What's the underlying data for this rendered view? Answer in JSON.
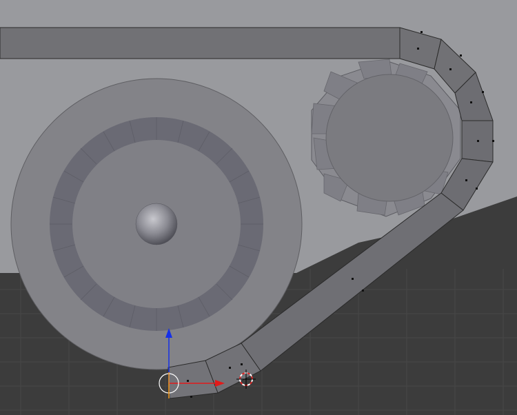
{
  "app": {
    "name": "3D viewport",
    "mode": "edit-mode",
    "view": "front-orthographic"
  },
  "colors": {
    "world_floor": "#3c3c3c",
    "grid_line": "#4a4a4a",
    "backplate": "#999a9e",
    "mesh_face": "#747478",
    "mesh_face_dark": "#6a6a70",
    "mesh_edge": "#2a2a2a",
    "vertex": "#111111",
    "axis_x": "#e31a1a",
    "axis_y": "#1530e8",
    "cursor_ring_a": "#e02a2a",
    "cursor_ring_b": "#ffffff",
    "pivot": "#f59a1c"
  },
  "objects": [
    {
      "name": "track-belt",
      "type": "mesh",
      "state": "edit"
    },
    {
      "name": "drive-wheel",
      "type": "mesh"
    },
    {
      "name": "sprocket",
      "type": "mesh"
    },
    {
      "name": "hub-sphere",
      "type": "mesh"
    }
  ],
  "gizmo": {
    "icons": {
      "x_arrow": "arrow-right-icon",
      "z_arrow": "arrow-up-icon",
      "pivot": "pivot-circle-icon",
      "cursor": "3d-cursor-icon"
    }
  }
}
